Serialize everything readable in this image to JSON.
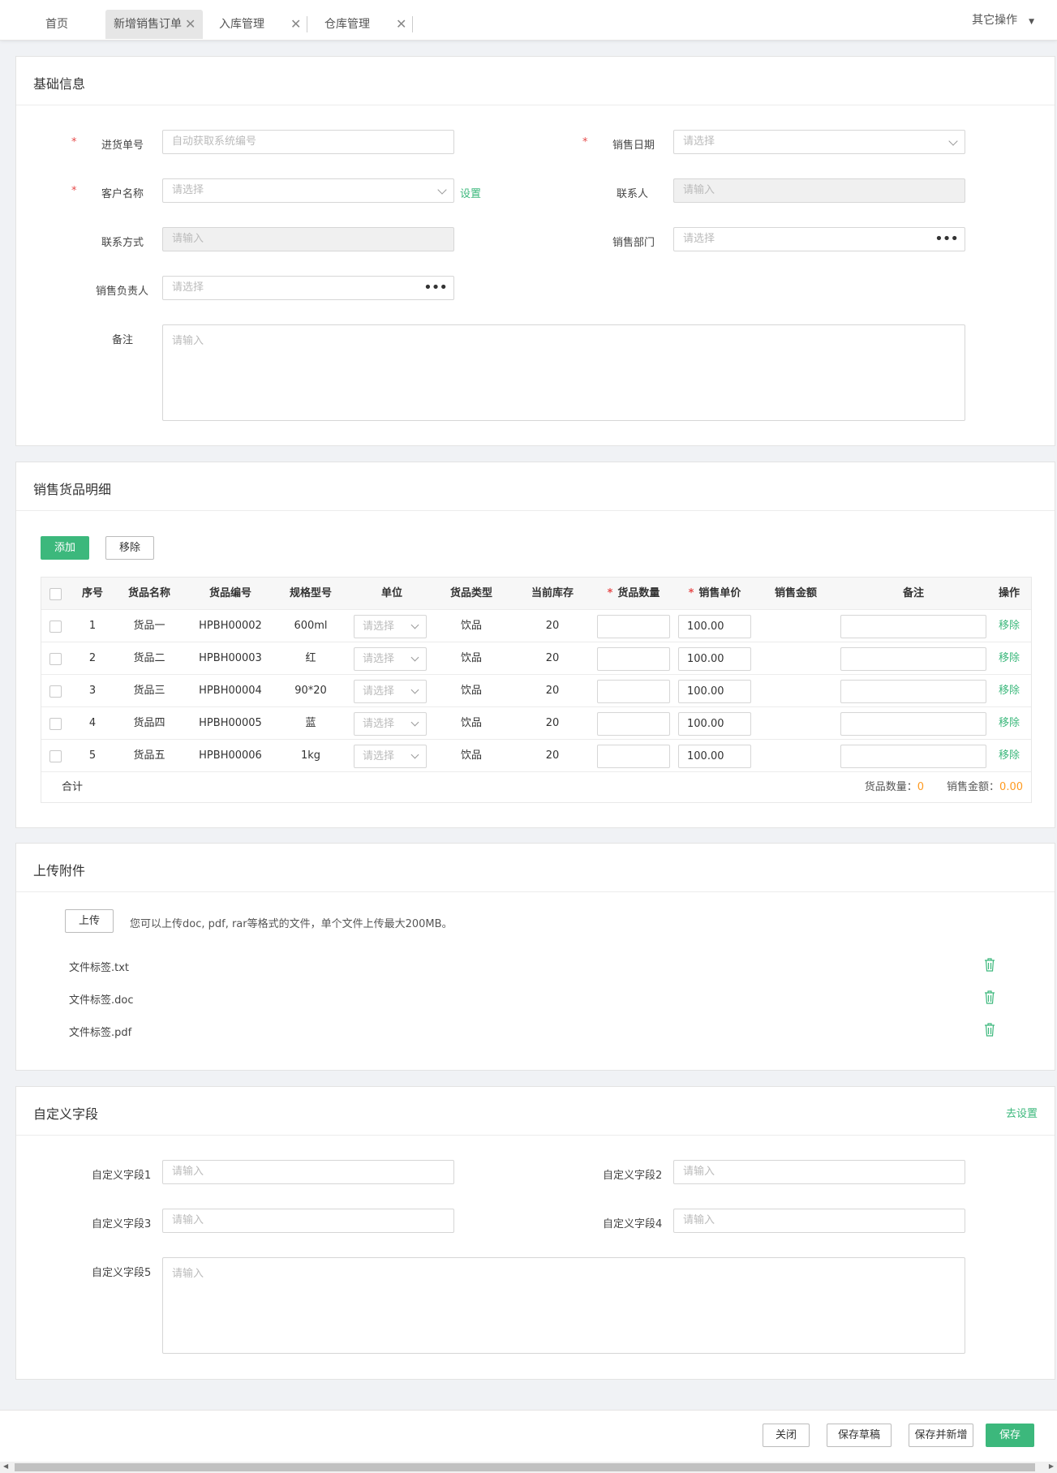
{
  "tabs": [
    {
      "label": "首页"
    },
    {
      "label": "新增销售订单",
      "close": "✕"
    },
    {
      "label": "入库管理",
      "close": "✕"
    },
    {
      "label": "仓库管理",
      "close": "✕"
    }
  ],
  "other_ops": "其它操作",
  "basic": {
    "title": "基础信息",
    "required_mark": "*",
    "order_no": {
      "label": "进货单号",
      "placeholder": "自动获取系统编号"
    },
    "sale_date": {
      "label": "销售日期",
      "placeholder": "请选择"
    },
    "customer": {
      "label": "客户名称",
      "placeholder": "请选择",
      "link": "设置"
    },
    "contact": {
      "label": "联系人",
      "placeholder": "请输入"
    },
    "contact_info": {
      "label": "联系方式",
      "placeholder": "请输入"
    },
    "department": {
      "label": "销售部门",
      "placeholder": "请选择"
    },
    "manager": {
      "label": "销售负责人",
      "placeholder": "请选择"
    },
    "remark": {
      "label": "备注",
      "placeholder": "请输入"
    }
  },
  "detail": {
    "title": "销售货品明细",
    "add_btn": "添加",
    "remove_btn": "移除",
    "headers": {
      "seq": "序号",
      "name": "货品名称",
      "code": "货品编号",
      "spec": "规格型号",
      "unit": "单位",
      "type": "货品类型",
      "stock": "当前库存",
      "qty": "货品数量",
      "price": "销售单价",
      "amount": "销售金额",
      "remark": "备注",
      "op": "操作"
    },
    "rows": [
      {
        "seq": "1",
        "name": "货品一",
        "code": "HPBH00002",
        "spec": "600ml",
        "unit": "请选择",
        "type": "饮品",
        "stock": "20",
        "qty": "",
        "price": "100.00",
        "amount": "",
        "remark": "",
        "op": "移除"
      },
      {
        "seq": "2",
        "name": "货品二",
        "code": "HPBH00003",
        "spec": "红",
        "unit": "请选择",
        "type": "饮品",
        "stock": "20",
        "qty": "",
        "price": "100.00",
        "amount": "",
        "remark": "",
        "op": "移除"
      },
      {
        "seq": "3",
        "name": "货品三",
        "code": "HPBH00004",
        "spec": "90*20",
        "unit": "请选择",
        "type": "饮品",
        "stock": "20",
        "qty": "",
        "price": "100.00",
        "amount": "",
        "remark": "",
        "op": "移除"
      },
      {
        "seq": "4",
        "name": "货品四",
        "code": "HPBH00005",
        "spec": "蓝",
        "unit": "请选择",
        "type": "饮品",
        "stock": "20",
        "qty": "",
        "price": "100.00",
        "amount": "",
        "remark": "",
        "op": "移除"
      },
      {
        "seq": "5",
        "name": "货品五",
        "code": "HPBH00006",
        "spec": "1kg",
        "unit": "请选择",
        "type": "饮品",
        "stock": "20",
        "qty": "",
        "price": "100.00",
        "amount": "",
        "remark": "",
        "op": "移除"
      }
    ],
    "total_label": "合计",
    "total_qty_label": "货品数量：",
    "total_qty": "0",
    "total_amount_label": "销售金额：",
    "total_amount": "0.00"
  },
  "attach": {
    "title": "上传附件",
    "upload_btn": "上传",
    "hint": "您可以上传doc, pdf, rar等格式的文件，单个文件上传最大200MB。",
    "files": [
      "文件标签.txt",
      "文件标签.doc",
      "文件标签.pdf"
    ]
  },
  "custom": {
    "title": "自定义字段",
    "link": "去设置",
    "fields": [
      {
        "label": "自定义字段1",
        "placeholder": "请输入"
      },
      {
        "label": "自定义字段2",
        "placeholder": "请输入"
      },
      {
        "label": "自定义字段3",
        "placeholder": "请输入"
      },
      {
        "label": "自定义字段4",
        "placeholder": "请输入"
      },
      {
        "label": "自定义字段5",
        "placeholder": "请输入"
      }
    ]
  },
  "footer": {
    "close": "关闭",
    "draft": "保存草稿",
    "save_new": "保存并新增",
    "save": "保存"
  },
  "colors": {
    "accent": "#3cb87c",
    "required": "#e64a4a",
    "highlight": "#ff9a1f"
  }
}
